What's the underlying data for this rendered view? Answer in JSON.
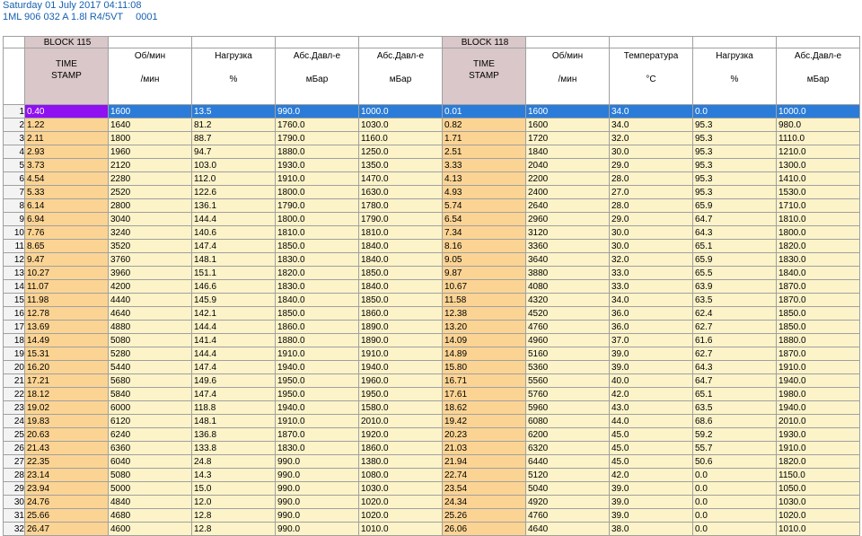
{
  "header": {
    "date_line": "Saturday 01 July 2017 04:11:08",
    "vehicle_line": "1ML 906 032 A  1.8l R4/5VT",
    "code": "0001"
  },
  "blocks": [
    "BLOCK 115",
    "BLOCK 118"
  ],
  "columns": [
    {
      "title": "TIME\nSTAMP",
      "unit": "",
      "type": "ts"
    },
    {
      "title": "Об/мин",
      "unit": "/мин",
      "type": "c"
    },
    {
      "title": "Нагрузка",
      "unit": "%",
      "type": "c"
    },
    {
      "title": "Абс.Давл-е",
      "unit": "мБар",
      "type": "c"
    },
    {
      "title": "Абс.Давл-е",
      "unit": "мБар",
      "type": "c"
    },
    {
      "title": "TIME\nSTAMP",
      "unit": "",
      "type": "ts"
    },
    {
      "title": "Об/мин",
      "unit": "/мин",
      "type": "c"
    },
    {
      "title": "Температура",
      "unit": "°C",
      "type": "c"
    },
    {
      "title": "Нагрузка",
      "unit": "%",
      "type": "c"
    },
    {
      "title": "Абс.Давл-е",
      "unit": "мБар",
      "type": "c"
    }
  ],
  "rows": [
    [
      "0.40",
      "1600",
      "13.5",
      "990.0",
      "1000.0",
      "0.01",
      "1600",
      "34.0",
      "0.0",
      "1000.0"
    ],
    [
      "1.22",
      "1640",
      "81.2",
      "1760.0",
      "1030.0",
      "0.82",
      "1600",
      "34.0",
      "95.3",
      "980.0"
    ],
    [
      "2.11",
      "1800",
      "88.7",
      "1790.0",
      "1160.0",
      "1.71",
      "1720",
      "32.0",
      "95.3",
      "1110.0"
    ],
    [
      "2.93",
      "1960",
      "94.7",
      "1880.0",
      "1250.0",
      "2.51",
      "1840",
      "30.0",
      "95.3",
      "1210.0"
    ],
    [
      "3.73",
      "2120",
      "103.0",
      "1930.0",
      "1350.0",
      "3.33",
      "2040",
      "29.0",
      "95.3",
      "1300.0"
    ],
    [
      "4.54",
      "2280",
      "112.0",
      "1910.0",
      "1470.0",
      "4.13",
      "2200",
      "28.0",
      "95.3",
      "1410.0"
    ],
    [
      "5.33",
      "2520",
      "122.6",
      "1800.0",
      "1630.0",
      "4.93",
      "2400",
      "27.0",
      "95.3",
      "1530.0"
    ],
    [
      "6.14",
      "2800",
      "136.1",
      "1790.0",
      "1780.0",
      "5.74",
      "2640",
      "28.0",
      "65.9",
      "1710.0"
    ],
    [
      "6.94",
      "3040",
      "144.4",
      "1800.0",
      "1790.0",
      "6.54",
      "2960",
      "29.0",
      "64.7",
      "1810.0"
    ],
    [
      "7.76",
      "3240",
      "140.6",
      "1810.0",
      "1810.0",
      "7.34",
      "3120",
      "30.0",
      "64.3",
      "1800.0"
    ],
    [
      "8.65",
      "3520",
      "147.4",
      "1850.0",
      "1840.0",
      "8.16",
      "3360",
      "30.0",
      "65.1",
      "1820.0"
    ],
    [
      "9.47",
      "3760",
      "148.1",
      "1830.0",
      "1840.0",
      "9.05",
      "3640",
      "32.0",
      "65.9",
      "1830.0"
    ],
    [
      "10.27",
      "3960",
      "151.1",
      "1820.0",
      "1850.0",
      "9.87",
      "3880",
      "33.0",
      "65.5",
      "1840.0"
    ],
    [
      "11.07",
      "4200",
      "146.6",
      "1830.0",
      "1840.0",
      "10.67",
      "4080",
      "33.0",
      "63.9",
      "1870.0"
    ],
    [
      "11.98",
      "4440",
      "145.9",
      "1840.0",
      "1850.0",
      "11.58",
      "4320",
      "34.0",
      "63.5",
      "1870.0"
    ],
    [
      "12.78",
      "4640",
      "142.1",
      "1850.0",
      "1860.0",
      "12.38",
      "4520",
      "36.0",
      "62.4",
      "1850.0"
    ],
    [
      "13.69",
      "4880",
      "144.4",
      "1860.0",
      "1890.0",
      "13.20",
      "4760",
      "36.0",
      "62.7",
      "1850.0"
    ],
    [
      "14.49",
      "5080",
      "141.4",
      "1880.0",
      "1890.0",
      "14.09",
      "4960",
      "37.0",
      "61.6",
      "1880.0"
    ],
    [
      "15.31",
      "5280",
      "144.4",
      "1910.0",
      "1910.0",
      "14.89",
      "5160",
      "39.0",
      "62.7",
      "1870.0"
    ],
    [
      "16.20",
      "5440",
      "147.4",
      "1940.0",
      "1940.0",
      "15.80",
      "5360",
      "39.0",
      "64.3",
      "1910.0"
    ],
    [
      "17.21",
      "5680",
      "149.6",
      "1950.0",
      "1960.0",
      "16.71",
      "5560",
      "40.0",
      "64.7",
      "1940.0"
    ],
    [
      "18.12",
      "5840",
      "147.4",
      "1950.0",
      "1950.0",
      "17.61",
      "5760",
      "42.0",
      "65.1",
      "1980.0"
    ],
    [
      "19.02",
      "6000",
      "118.8",
      "1940.0",
      "1580.0",
      "18.62",
      "5960",
      "43.0",
      "63.5",
      "1940.0"
    ],
    [
      "19.83",
      "6120",
      "148.1",
      "1910.0",
      "2010.0",
      "19.42",
      "6080",
      "44.0",
      "68.6",
      "2010.0"
    ],
    [
      "20.63",
      "6240",
      "136.8",
      "1870.0",
      "1920.0",
      "20.23",
      "6200",
      "45.0",
      "59.2",
      "1930.0"
    ],
    [
      "21.43",
      "6360",
      "133.8",
      "1830.0",
      "1860.0",
      "21.03",
      "6320",
      "45.0",
      "55.7",
      "1910.0"
    ],
    [
      "22.35",
      "6040",
      "24.8",
      "990.0",
      "1380.0",
      "21.94",
      "6440",
      "45.0",
      "50.6",
      "1820.0"
    ],
    [
      "23.14",
      "5080",
      "14.3",
      "990.0",
      "1080.0",
      "22.74",
      "5120",
      "42.0",
      "0.0",
      "1150.0"
    ],
    [
      "23.94",
      "5000",
      "15.0",
      "990.0",
      "1030.0",
      "23.54",
      "5040",
      "39.0",
      "0.0",
      "1050.0"
    ],
    [
      "24.76",
      "4840",
      "12.0",
      "990.0",
      "1020.0",
      "24.34",
      "4920",
      "39.0",
      "0.0",
      "1030.0"
    ],
    [
      "25.66",
      "4680",
      "12.8",
      "990.0",
      "1020.0",
      "25.26",
      "4760",
      "39.0",
      "0.0",
      "1020.0"
    ],
    [
      "26.47",
      "4600",
      "12.8",
      "990.0",
      "1010.0",
      "26.06",
      "4640",
      "38.0",
      "0.0",
      "1010.0"
    ]
  ],
  "selected_row": 1,
  "colors": {
    "accent": "#1560b0",
    "selection": "#2b7cd8",
    "cursor": "#8f10f0",
    "cell": "#fcf3c8",
    "timestamp": "#fbd494"
  }
}
